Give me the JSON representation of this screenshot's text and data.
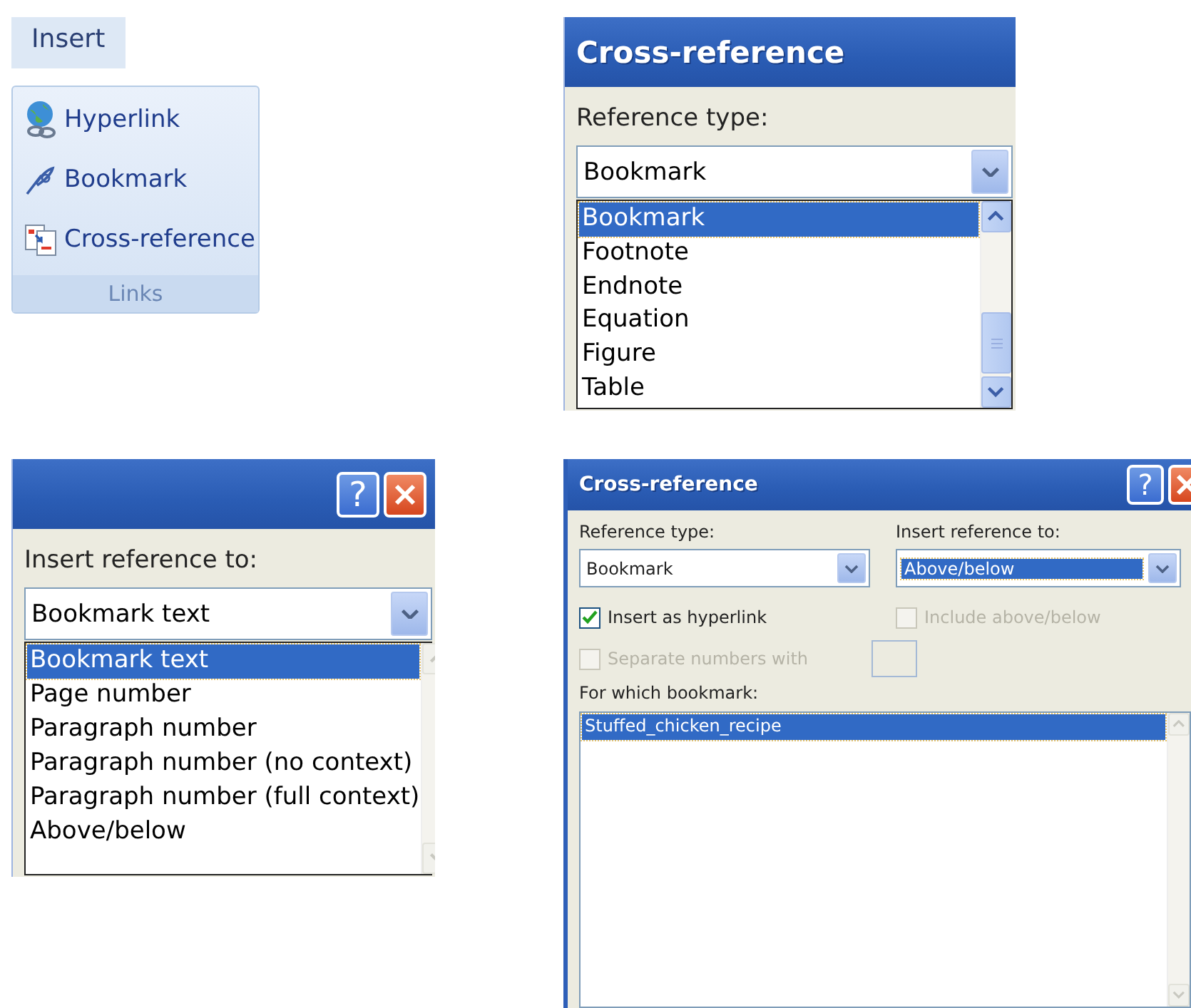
{
  "ribbon": {
    "tab": "Insert",
    "items": [
      {
        "kind": "hyperlink",
        "label": "Hyperlink"
      },
      {
        "kind": "bookmark",
        "label": "Bookmark"
      },
      {
        "kind": "cross_reference",
        "label": "Cross-reference"
      }
    ],
    "group": "Links"
  },
  "reference_type_popup": {
    "title": "Cross-reference",
    "label": "Reference type:",
    "value": "Bookmark",
    "options": [
      {
        "label": "Bookmark",
        "selected": true
      },
      {
        "label": "Footnote",
        "selected": false
      },
      {
        "label": "Endnote",
        "selected": false
      },
      {
        "label": "Equation",
        "selected": false
      },
      {
        "label": "Figure",
        "selected": false
      },
      {
        "label": "Table",
        "selected": false
      }
    ]
  },
  "insert_reference_popup": {
    "help_button": "?",
    "label": "Insert reference to:",
    "value": "Bookmark text",
    "options": [
      {
        "label": "Bookmark text",
        "selected": true
      },
      {
        "label": "Page number",
        "selected": false
      },
      {
        "label": "Paragraph number",
        "selected": false
      },
      {
        "label": "Paragraph number (no context)",
        "selected": false
      },
      {
        "label": "Paragraph number (full context)",
        "selected": false
      },
      {
        "label": "Above/below",
        "selected": false
      }
    ]
  },
  "dialog": {
    "title": "Cross-reference",
    "help_button": "?",
    "reference_type": {
      "label": "Reference type:",
      "value": "Bookmark",
      "focused": false
    },
    "insert_reference_to": {
      "label": "Insert reference to:",
      "value": "Above/below",
      "focused": true
    },
    "insert_as_hyperlink": {
      "label": "Insert as hyperlink",
      "checked": true,
      "disabled": false
    },
    "include_above_below": {
      "label": "Include above/below",
      "checked": false,
      "disabled": true
    },
    "separate_numbers": {
      "label": "Separate numbers with",
      "checked": false,
      "disabled": true
    },
    "bookmark_list": {
      "label": "For which bookmark:",
      "items": [
        {
          "label": "Stuffed_chicken_recipe",
          "selected": true
        }
      ]
    }
  }
}
